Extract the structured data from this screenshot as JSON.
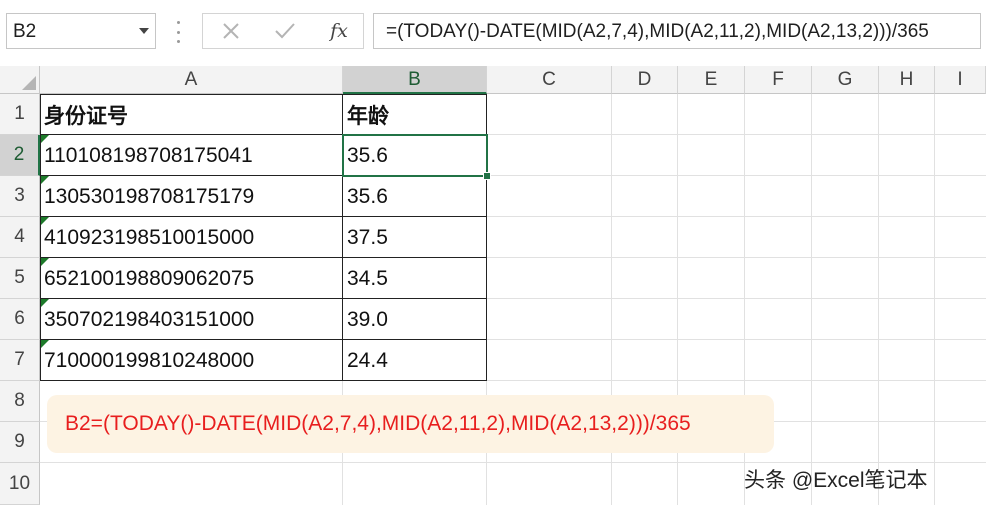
{
  "formula_bar": {
    "name_box": "B2",
    "cancel_glyph": "✕",
    "enter_glyph": "✓",
    "fx_label": "fx",
    "formula": "=(TODAY()-DATE(MID(A2,7,4),MID(A2,11,2),MID(A2,13,2)))/365"
  },
  "columns": [
    "A",
    "B",
    "C",
    "D",
    "E",
    "F",
    "G",
    "H",
    "I"
  ],
  "rows": [
    "1",
    "2",
    "3",
    "4",
    "5",
    "6",
    "7",
    "8",
    "9",
    "10"
  ],
  "table": {
    "headers": [
      "身份证号",
      "年龄"
    ],
    "rows": [
      [
        "110108198708175041",
        "35.6"
      ],
      [
        "130530198708175179",
        "35.6"
      ],
      [
        "410923198510015000",
        "37.5"
      ],
      [
        "652100198809062075",
        "34.5"
      ],
      [
        "350702198403151000",
        "39.0"
      ],
      [
        "710000199810248000",
        "24.4"
      ]
    ]
  },
  "selected_cell": "B2",
  "note": {
    "text": "B2=(TODAY()-DATE(MID(A2,7,4),MID(A2,11,2),MID(A2,13,2)))/365"
  },
  "watermark": "头条 @Excel笔记本",
  "colors": {
    "accent_green": "#217346",
    "note_bg": "#fdf3e3",
    "note_text": "#e81e1e",
    "error_triangle": "#1d7a2a"
  }
}
